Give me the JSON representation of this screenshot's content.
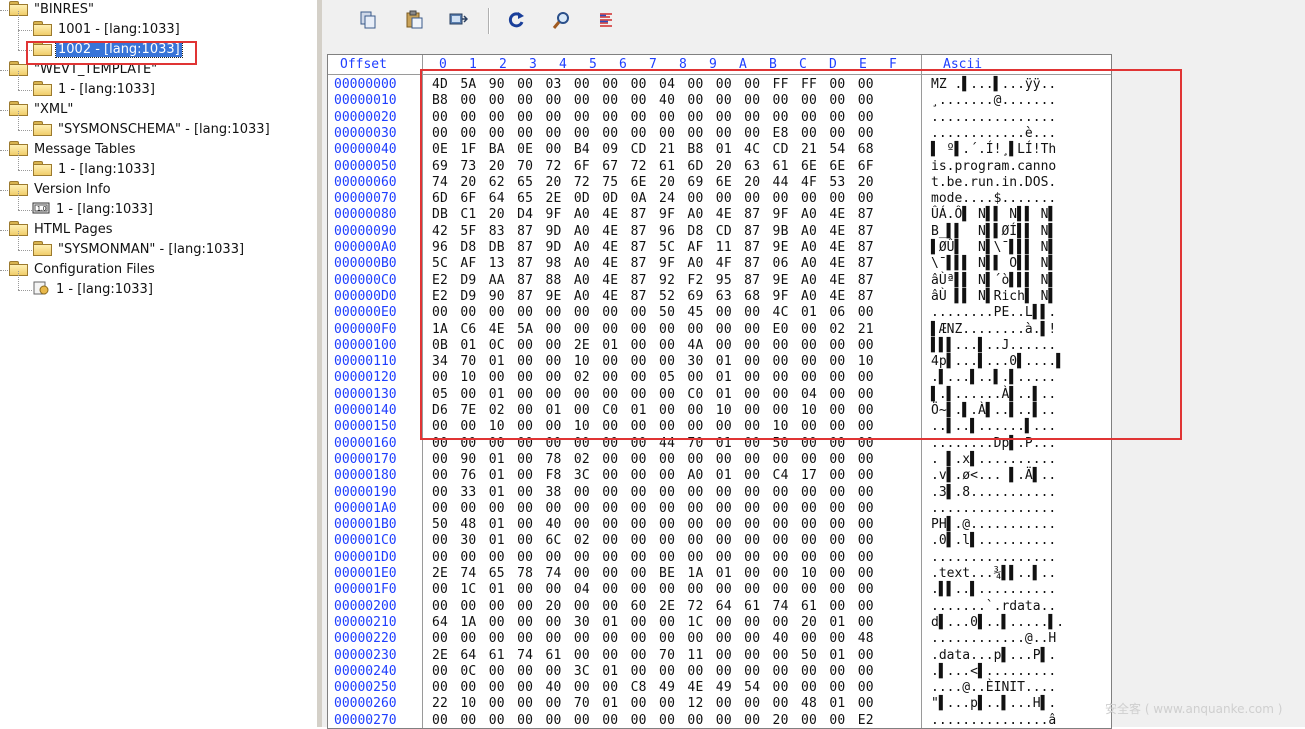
{
  "tree": {
    "items": [
      {
        "label": "\"BINRES\"",
        "icon": "folder-icon",
        "level": 0
      },
      {
        "label": "1001 - [lang:1033]",
        "icon": "folder-icon",
        "level": 1
      },
      {
        "label": "1002 - [lang:1033]",
        "icon": "folder-icon",
        "level": 1,
        "selected": true
      },
      {
        "label": "\"WEVT_TEMPLATE\"",
        "icon": "folder-icon",
        "level": 0
      },
      {
        "label": "1 - [lang:1033]",
        "icon": "folder-icon",
        "level": 1
      },
      {
        "label": "\"XML\"",
        "icon": "folder-icon",
        "level": 0
      },
      {
        "label": "\"SYSMONSCHEMA\" - [lang:1033]",
        "icon": "folder-icon",
        "level": 1
      },
      {
        "label": "Message Tables",
        "icon": "folder-icon",
        "level": 0
      },
      {
        "label": "1 - [lang:1033]",
        "icon": "folder-icon",
        "level": 1
      },
      {
        "label": "Version Info",
        "icon": "folder-icon",
        "level": 0
      },
      {
        "label": "1 - [lang:1033]",
        "icon": "version-info-icon",
        "level": 1
      },
      {
        "label": "HTML Pages",
        "icon": "folder-icon",
        "level": 0
      },
      {
        "label": "\"SYSMONMAN\" - [lang:1033]",
        "icon": "folder-icon",
        "level": 1
      },
      {
        "label": "Configuration Files",
        "icon": "folder-icon",
        "level": 0
      },
      {
        "label": "1 - [lang:1033]",
        "icon": "config-file-icon",
        "level": 1
      }
    ]
  },
  "toolbar": {
    "buttons": [
      {
        "name": "copy-icon"
      },
      {
        "name": "paste-icon"
      },
      {
        "name": "replace-icon"
      },
      {
        "name": "refresh-icon"
      },
      {
        "name": "find-icon"
      },
      {
        "name": "text-view-icon"
      }
    ]
  },
  "hex": {
    "offset_header": "Offset",
    "column_headers": [
      "0",
      "1",
      "2",
      "3",
      "4",
      "5",
      "6",
      "7",
      "8",
      "9",
      "A",
      "B",
      "C",
      "D",
      "E",
      "F"
    ],
    "ascii_header": "Ascii",
    "rows": [
      {
        "offset": "00000000",
        "bytes": "4D 5A 90 00 03 00 00 00 04 00 00 00 FF FF 00 00",
        "ascii": "MZ .▌...▌...ÿÿ.."
      },
      {
        "offset": "00000010",
        "bytes": "B8 00 00 00 00 00 00 00 40 00 00 00 00 00 00 00",
        "ascii": "¸.......@......."
      },
      {
        "offset": "00000020",
        "bytes": "00 00 00 00 00 00 00 00 00 00 00 00 00 00 00 00",
        "ascii": "................"
      },
      {
        "offset": "00000030",
        "bytes": "00 00 00 00 00 00 00 00 00 00 00 00 E8 00 00 00",
        "ascii": "............è..."
      },
      {
        "offset": "00000040",
        "bytes": "0E 1F BA 0E 00 B4 09 CD 21 B8 01 4C CD 21 54 68",
        "ascii": "▌ º▌.´.Í!¸▌LÍ!Th"
      },
      {
        "offset": "00000050",
        "bytes": "69 73 20 70 72 6F 67 72 61 6D 20 63 61 6E 6E 6F",
        "ascii": "is.program.canno"
      },
      {
        "offset": "00000060",
        "bytes": "74 20 62 65 20 72 75 6E 20 69 6E 20 44 4F 53 20",
        "ascii": "t.be.run.in.DOS."
      },
      {
        "offset": "00000070",
        "bytes": "6D 6F 64 65 2E 0D 0D 0A 24 00 00 00 00 00 00 00",
        "ascii": "mode....$......."
      },
      {
        "offset": "00000080",
        "bytes": "DB C1 20 D4 9F A0 4E 87 9F A0 4E 87 9F A0 4E 87",
        "ascii": "ÛÁ.Ô▌ N▌▌ N▌▌ N▌"
      },
      {
        "offset": "00000090",
        "bytes": "42 5F 83 87 9D A0 4E 87 96 D8 CD 87 9B A0 4E 87",
        "ascii": "B_▌▌  N▌▌ØÍ▌▌ N▌"
      },
      {
        "offset": "000000A0",
        "bytes": "96 D8 DB 87 9D A0 4E 87 5C AF 11 87 9E A0 4E 87",
        "ascii": "▌ØÛ▌  N▌\\¯▌▌▌ N▌"
      },
      {
        "offset": "000000B0",
        "bytes": "5C AF 13 87 98 A0 4E 87 9F A0 4F 87 06 A0 4E 87",
        "ascii": "\\¯▌▌▌ N▌▌ O▌▌ N▌"
      },
      {
        "offset": "000000C0",
        "bytes": "E2 D9 AA 87 88 A0 4E 87 92 F2 95 87 9E A0 4E 87",
        "ascii": "âÙª▌▌ N▌´ò▌▌▌ N▌"
      },
      {
        "offset": "000000D0",
        "bytes": "E2 D9 90 87 9E A0 4E 87 52 69 63 68 9F A0 4E 87",
        "ascii": "âÙ ▌▌ N▌Rich▌ N▌"
      },
      {
        "offset": "000000E0",
        "bytes": "00 00 00 00 00 00 00 00 50 45 00 00 4C 01 06 00",
        "ascii": "........PE..L▌▌."
      },
      {
        "offset": "000000F0",
        "bytes": "1A C6 4E 5A 00 00 00 00 00 00 00 00 E0 00 02 21",
        "ascii": "▌ÆNZ........à.▌!"
      },
      {
        "offset": "00000100",
        "bytes": "0B 01 0C 00 00 2E 01 00 00 4A 00 00 00 00 00 00",
        "ascii": "▌▌▌...▌..J......"
      },
      {
        "offset": "00000110",
        "bytes": "34 70 01 00 00 10 00 00 00 30 01 00 00 00 00 10",
        "ascii": "4p▌...▌...0▌....▌"
      },
      {
        "offset": "00000120",
        "bytes": "00 10 00 00 00 02 00 00 05 00 01 00 00 00 00 00",
        "ascii": ".▌...▌..▌.▌....."
      },
      {
        "offset": "00000130",
        "bytes": "05 00 01 00 00 00 00 00 00 C0 01 00 00 04 00 00",
        "ascii": "▌.▌......À▌..▌.."
      },
      {
        "offset": "00000140",
        "bytes": "D6 7E 02 00 01 00 C0 01 00 00 10 00 00 10 00 00",
        "ascii": "Ö~▌.▌.À▌..▌..▌.."
      },
      {
        "offset": "00000150",
        "bytes": "00 00 10 00 00 10 00 00 00 00 00 00 10 00 00 00",
        "ascii": "..▌..▌......▌..."
      },
      {
        "offset": "00000160",
        "bytes": "00 00 00 00 00 00 00 00 44 70 01 00 50 00 00 00",
        "ascii": "........Dp▌.P..."
      },
      {
        "offset": "00000170",
        "bytes": "00 90 01 00 78 02 00 00 00 00 00 00 00 00 00 00",
        "ascii": ". ▌.x▌.........."
      },
      {
        "offset": "00000180",
        "bytes": "00 76 01 00 F8 3C 00 00 00 A0 01 00 C4 17 00 00",
        "ascii": ".v▌.ø<... ▌.Ä▌.."
      },
      {
        "offset": "00000190",
        "bytes": "00 33 01 00 38 00 00 00 00 00 00 00 00 00 00 00",
        "ascii": ".3▌.8..........."
      },
      {
        "offset": "000001A0",
        "bytes": "00 00 00 00 00 00 00 00 00 00 00 00 00 00 00 00",
        "ascii": "................"
      },
      {
        "offset": "000001B0",
        "bytes": "50 48 01 00 40 00 00 00 00 00 00 00 00 00 00 00",
        "ascii": "PH▌.@..........."
      },
      {
        "offset": "000001C0",
        "bytes": "00 30 01 00 6C 02 00 00 00 00 00 00 00 00 00 00",
        "ascii": ".0▌.l▌.........."
      },
      {
        "offset": "000001D0",
        "bytes": "00 00 00 00 00 00 00 00 00 00 00 00 00 00 00 00",
        "ascii": "................"
      },
      {
        "offset": "000001E0",
        "bytes": "2E 74 65 78 74 00 00 00 BE 1A 01 00 00 10 00 00",
        "ascii": ".text...¾▌▌..▌.."
      },
      {
        "offset": "000001F0",
        "bytes": "00 1C 01 00 00 04 00 00 00 00 00 00 00 00 00 00",
        "ascii": ".▌▌..▌.........."
      },
      {
        "offset": "00000200",
        "bytes": "00 00 00 00 20 00 00 60 2E 72 64 61 74 61 00 00",
        "ascii": ".......`.rdata.."
      },
      {
        "offset": "00000210",
        "bytes": "64 1A 00 00 00 30 01 00 00 1C 00 00 00 20 01 00",
        "ascii": "d▌...0▌..▌.....▌."
      },
      {
        "offset": "00000220",
        "bytes": "00 00 00 00 00 00 00 00 00 00 00 00 40 00 00 48",
        "ascii": "............@..H"
      },
      {
        "offset": "00000230",
        "bytes": "2E 64 61 74 61 00 00 00 70 11 00 00 00 50 01 00",
        "ascii": ".data...p▌...P▌."
      },
      {
        "offset": "00000240",
        "bytes": "00 0C 00 00 00 3C 01 00 00 00 00 00 00 00 00 00",
        "ascii": ".▌...<▌........."
      },
      {
        "offset": "00000250",
        "bytes": "00 00 00 00 40 00 00 C8 49 4E 49 54 00 00 00 00",
        "ascii": "....@..ÈINIT...."
      },
      {
        "offset": "00000260",
        "bytes": "22 10 00 00 00 70 01 00 00 12 00 00 00 48 01 00",
        "ascii": "\"▌...p▌..▌...H▌."
      },
      {
        "offset": "00000270",
        "bytes": "00 00 00 00 00 00 00 00 00 00 00 00 20 00 00 E2",
        "ascii": "...............â"
      }
    ]
  },
  "watermark": "安全客 ( www.anquanke.com )",
  "colors": {
    "selection": "#3874d8",
    "highlight_box": "#e03434",
    "header_text": "#1f3fff"
  }
}
